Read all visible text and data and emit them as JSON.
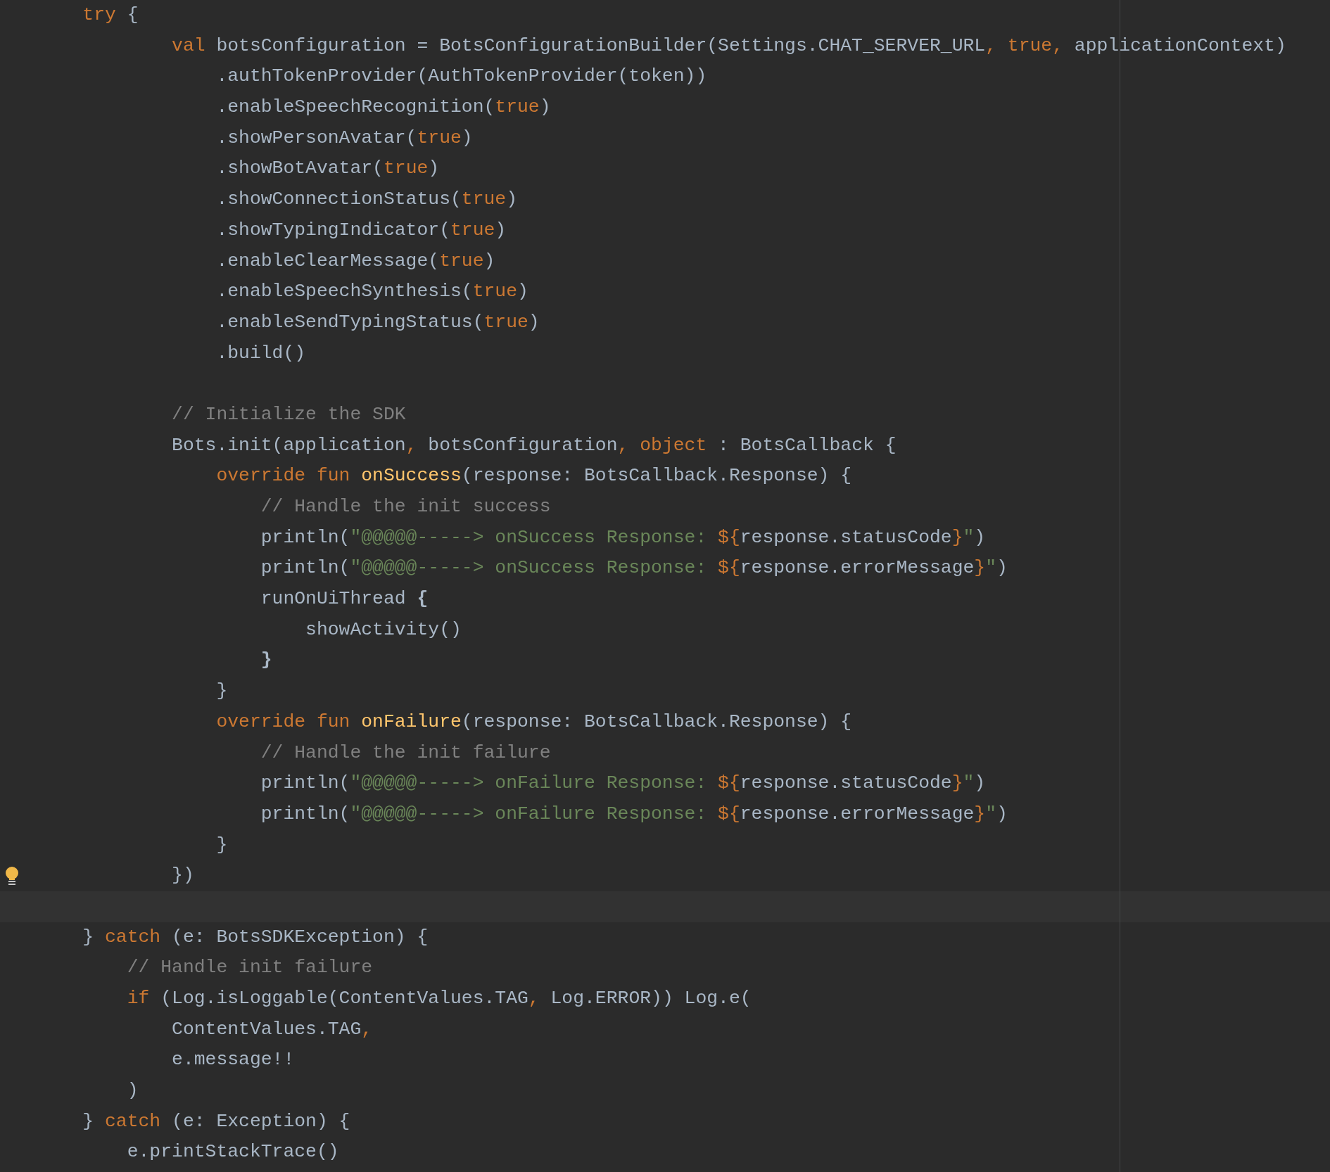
{
  "editor": {
    "lines": [
      {
        "kind": "code",
        "bulb": false,
        "tokens": [
          {
            "t": "    try",
            "kind": "keyword"
          },
          {
            "t": " {",
            "kind": "plain"
          }
        ]
      },
      {
        "kind": "code",
        "bulb": false,
        "tokens": [
          {
            "t": "            val",
            "kind": "keyword"
          },
          {
            "t": " botsConfiguration = BotsConfigurationBuilder(Settings.CHAT_SERVER_URL",
            "kind": "plain"
          },
          {
            "t": ", true,",
            "kind": "keyword"
          },
          {
            "t": " applicationContext)",
            "kind": "plain"
          }
        ]
      },
      {
        "kind": "code",
        "bulb": false,
        "tokens": [
          {
            "t": "                .authTokenProvider(AuthTokenProvider(token))",
            "kind": "plain"
          }
        ]
      },
      {
        "kind": "code",
        "bulb": false,
        "tokens": [
          {
            "t": "                .enableSpeechRecognition(",
            "kind": "plain"
          },
          {
            "t": "true",
            "kind": "keyword"
          },
          {
            "t": ")",
            "kind": "plain"
          }
        ]
      },
      {
        "kind": "code",
        "bulb": false,
        "tokens": [
          {
            "t": "                .showPersonAvatar(",
            "kind": "plain"
          },
          {
            "t": "true",
            "kind": "keyword"
          },
          {
            "t": ")",
            "kind": "plain"
          }
        ]
      },
      {
        "kind": "code",
        "bulb": false,
        "tokens": [
          {
            "t": "                .showBotAvatar(",
            "kind": "plain"
          },
          {
            "t": "true",
            "kind": "keyword"
          },
          {
            "t": ")",
            "kind": "plain"
          }
        ]
      },
      {
        "kind": "code",
        "bulb": false,
        "tokens": [
          {
            "t": "                .showConnectionStatus(",
            "kind": "plain"
          },
          {
            "t": "true",
            "kind": "keyword"
          },
          {
            "t": ")",
            "kind": "plain"
          }
        ]
      },
      {
        "kind": "code",
        "bulb": false,
        "tokens": [
          {
            "t": "                .showTypingIndicator(",
            "kind": "plain"
          },
          {
            "t": "true",
            "kind": "keyword"
          },
          {
            "t": ")",
            "kind": "plain"
          }
        ]
      },
      {
        "kind": "code",
        "bulb": false,
        "tokens": [
          {
            "t": "                .enableClearMessage(",
            "kind": "plain"
          },
          {
            "t": "true",
            "kind": "keyword"
          },
          {
            "t": ")",
            "kind": "plain"
          }
        ]
      },
      {
        "kind": "code",
        "bulb": false,
        "tokens": [
          {
            "t": "                .enableSpeechSynthesis(",
            "kind": "plain"
          },
          {
            "t": "true",
            "kind": "keyword"
          },
          {
            "t": ")",
            "kind": "plain"
          }
        ]
      },
      {
        "kind": "code",
        "bulb": false,
        "tokens": [
          {
            "t": "                .enableSendTypingStatus(",
            "kind": "plain"
          },
          {
            "t": "true",
            "kind": "keyword"
          },
          {
            "t": ")",
            "kind": "plain"
          }
        ]
      },
      {
        "kind": "code",
        "bulb": false,
        "tokens": [
          {
            "t": "                .build()",
            "kind": "plain"
          }
        ]
      },
      {
        "kind": "blank",
        "bulb": false
      },
      {
        "kind": "code",
        "bulb": false,
        "tokens": [
          {
            "t": "            // Initialize the SDK",
            "kind": "comment"
          }
        ]
      },
      {
        "kind": "code",
        "bulb": false,
        "tokens": [
          {
            "t": "            Bots.init(application",
            "kind": "plain"
          },
          {
            "t": ",",
            "kind": "keyword"
          },
          {
            "t": " botsConfiguration",
            "kind": "plain"
          },
          {
            "t": ", object",
            "kind": "keyword"
          },
          {
            "t": " : BotsCallback {",
            "kind": "plain"
          }
        ]
      },
      {
        "kind": "code",
        "bulb": false,
        "tokens": [
          {
            "t": "                override fun",
            "kind": "keyword"
          },
          {
            "t": " onSuccess",
            "kind": "function"
          },
          {
            "t": "(response: BotsCallback.Response) {",
            "kind": "plain"
          }
        ]
      },
      {
        "kind": "code",
        "bulb": false,
        "tokens": [
          {
            "t": "                    // Handle the init success",
            "kind": "comment"
          }
        ]
      },
      {
        "kind": "code",
        "bulb": false,
        "tokens": [
          {
            "t": "                    println(",
            "kind": "plain"
          },
          {
            "t": "\"@@@@@-----> onSuccess Response: ",
            "kind": "string"
          },
          {
            "t": "${",
            "kind": "keyword"
          },
          {
            "t": "response.statusCode",
            "kind": "plain"
          },
          {
            "t": "}",
            "kind": "keyword"
          },
          {
            "t": "\"",
            "kind": "string"
          },
          {
            "t": ")",
            "kind": "plain"
          }
        ]
      },
      {
        "kind": "code",
        "bulb": false,
        "tokens": [
          {
            "t": "                    println(",
            "kind": "plain"
          },
          {
            "t": "\"@@@@@-----> onSuccess Response: ",
            "kind": "string"
          },
          {
            "t": "${",
            "kind": "keyword"
          },
          {
            "t": "response.errorMessage",
            "kind": "plain"
          },
          {
            "t": "}",
            "kind": "keyword"
          },
          {
            "t": "\"",
            "kind": "string"
          },
          {
            "t": ")",
            "kind": "plain"
          }
        ]
      },
      {
        "kind": "code",
        "bulb": false,
        "tokens": [
          {
            "t": "                    runOnUiThread",
            "kind": "plain"
          },
          {
            "t": " {",
            "kind": "bold"
          }
        ]
      },
      {
        "kind": "code",
        "bulb": false,
        "tokens": [
          {
            "t": "                        showActivity()",
            "kind": "plain"
          }
        ]
      },
      {
        "kind": "code",
        "bulb": false,
        "tokens": [
          {
            "t": "                    }",
            "kind": "bold"
          }
        ]
      },
      {
        "kind": "code",
        "bulb": false,
        "tokens": [
          {
            "t": "                }",
            "kind": "plain"
          }
        ]
      },
      {
        "kind": "code",
        "bulb": false,
        "tokens": [
          {
            "t": "                override fun",
            "kind": "keyword"
          },
          {
            "t": " onFailure",
            "kind": "function"
          },
          {
            "t": "(response: BotsCallback.Response) {",
            "kind": "plain"
          }
        ]
      },
      {
        "kind": "code",
        "bulb": false,
        "tokens": [
          {
            "t": "                    // Handle the init failure",
            "kind": "comment"
          }
        ]
      },
      {
        "kind": "code",
        "bulb": false,
        "tokens": [
          {
            "t": "                    println(",
            "kind": "plain"
          },
          {
            "t": "\"@@@@@-----> onFailure Response: ",
            "kind": "string"
          },
          {
            "t": "${",
            "kind": "keyword"
          },
          {
            "t": "response.statusCode",
            "kind": "plain"
          },
          {
            "t": "}",
            "kind": "keyword"
          },
          {
            "t": "\"",
            "kind": "string"
          },
          {
            "t": ")",
            "kind": "plain"
          }
        ]
      },
      {
        "kind": "code",
        "bulb": false,
        "tokens": [
          {
            "t": "                    println(",
            "kind": "plain"
          },
          {
            "t": "\"@@@@@-----> onFailure Response: ",
            "kind": "string"
          },
          {
            "t": "${",
            "kind": "keyword"
          },
          {
            "t": "response.errorMessage",
            "kind": "plain"
          },
          {
            "t": "}",
            "kind": "keyword"
          },
          {
            "t": "\"",
            "kind": "string"
          },
          {
            "t": ")",
            "kind": "plain"
          }
        ]
      },
      {
        "kind": "code",
        "bulb": false,
        "tokens": [
          {
            "t": "                }",
            "kind": "plain"
          }
        ]
      },
      {
        "kind": "code",
        "bulb": true,
        "tokens": [
          {
            "t": "            })",
            "kind": "plain"
          }
        ]
      },
      {
        "kind": "caret",
        "bulb": false
      },
      {
        "kind": "code",
        "bulb": false,
        "tokens": [
          {
            "t": "    }",
            "kind": "plain"
          },
          {
            "t": " catch",
            "kind": "keyword"
          },
          {
            "t": " (e: BotsSDKException) {",
            "kind": "plain"
          }
        ]
      },
      {
        "kind": "code",
        "bulb": false,
        "tokens": [
          {
            "t": "        // Handle init failure",
            "kind": "comment"
          }
        ]
      },
      {
        "kind": "code",
        "bulb": false,
        "tokens": [
          {
            "t": "        if",
            "kind": "keyword"
          },
          {
            "t": " (Log.isLoggable(ContentValues.TAG",
            "kind": "plain"
          },
          {
            "t": ",",
            "kind": "keyword"
          },
          {
            "t": " Log.ERROR)) Log.e(",
            "kind": "plain"
          }
        ]
      },
      {
        "kind": "code",
        "bulb": false,
        "tokens": [
          {
            "t": "            ContentValues.TAG",
            "kind": "plain"
          },
          {
            "t": ",",
            "kind": "keyword"
          }
        ]
      },
      {
        "kind": "code",
        "bulb": false,
        "tokens": [
          {
            "t": "            e.message!!",
            "kind": "plain"
          }
        ]
      },
      {
        "kind": "code",
        "bulb": false,
        "tokens": [
          {
            "t": "        )",
            "kind": "plain"
          }
        ]
      },
      {
        "kind": "code",
        "bulb": false,
        "tokens": [
          {
            "t": "    }",
            "kind": "plain"
          },
          {
            "t": " catch",
            "kind": "keyword"
          },
          {
            "t": " (e: Exception) {",
            "kind": "plain"
          }
        ]
      },
      {
        "kind": "code",
        "bulb": false,
        "tokens": [
          {
            "t": "        e.printStackTrace()",
            "kind": "plain"
          }
        ]
      }
    ]
  }
}
